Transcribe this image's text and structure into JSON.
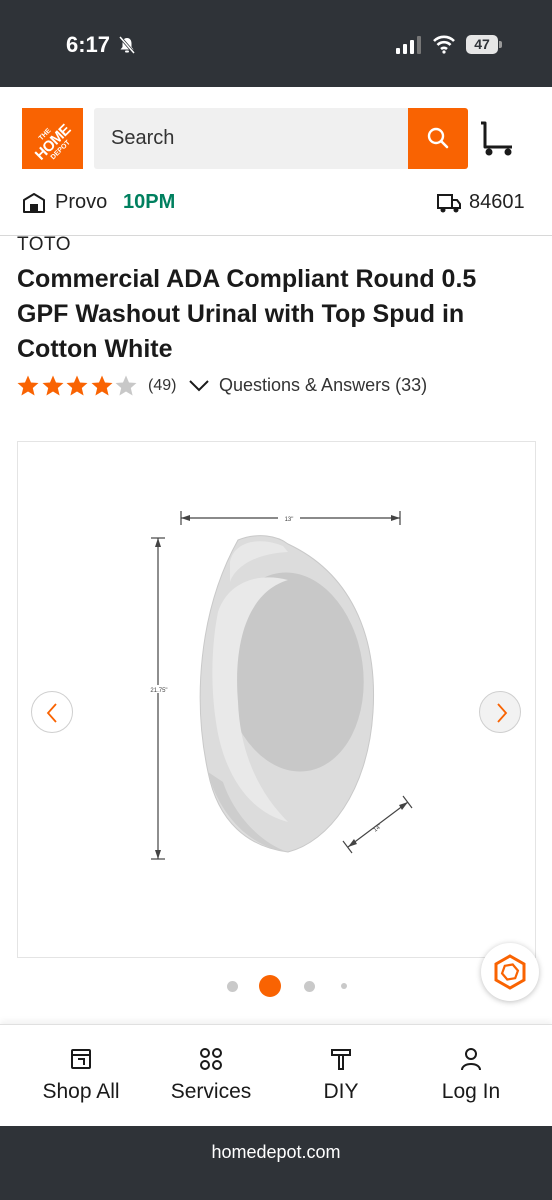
{
  "status_bar": {
    "time": "6:17",
    "battery": "47"
  },
  "header": {
    "logo_line1": "THE",
    "logo_line2": "HOME",
    "logo_line3": "DEPOT",
    "search_placeholder": "Search",
    "store_name": "Provo",
    "store_hours": "10PM",
    "zip_code": "84601"
  },
  "product": {
    "brand": "TOTO",
    "title": "Commercial ADA Compliant Round 0.5 GPF Washout Urinal with Top Spud in Cotton White",
    "rating": 4,
    "rating_max": 5,
    "review_count": "(49)",
    "qa_link": "Questions & Answers (33)",
    "dimensions": {
      "width": "13\"",
      "height": "21.75\"",
      "depth": "14\""
    }
  },
  "carousel": {
    "dot_count": 4,
    "active_index": 1
  },
  "colors": {
    "brand_orange": "#f96302",
    "store_green": "#00805f",
    "bar_dark": "#2f3338"
  },
  "bottom_nav": {
    "items": [
      {
        "label": "Shop All",
        "icon": "shop-all-icon"
      },
      {
        "label": "Services",
        "icon": "services-icon"
      },
      {
        "label": "DIY",
        "icon": "diy-icon"
      },
      {
        "label": "Log In",
        "icon": "person-icon"
      }
    ]
  },
  "browser": {
    "url": "homedepot.com"
  }
}
